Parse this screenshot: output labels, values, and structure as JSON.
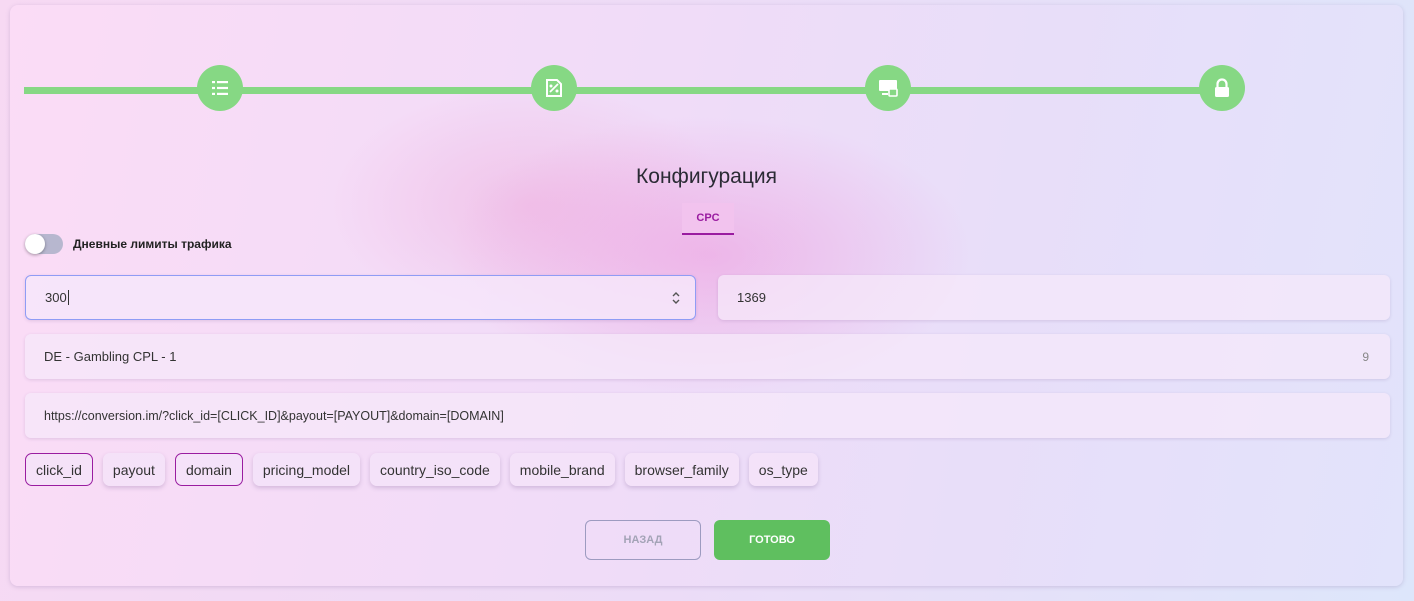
{
  "stepper": {
    "steps": [
      {
        "icon": "list-icon"
      },
      {
        "icon": "pricing-tag-icon"
      },
      {
        "icon": "monitor-icon"
      },
      {
        "icon": "lock-icon"
      }
    ],
    "color": "#86d884"
  },
  "section": {
    "title": "Конфигурация",
    "tab_label": "CPC",
    "accent_color": "#9a1ca0"
  },
  "daily_limits": {
    "label": "Дневные лимиты трафика",
    "enabled": false
  },
  "form": {
    "payout_value": "300",
    "id_value": "1369",
    "offer_value": "DE - Gambling CPL - 1",
    "offer_count": "9",
    "postback_url": "https://conversion.im/?click_id=[CLICK_ID]&payout=[PAYOUT]&domain=[DOMAIN]"
  },
  "macros": [
    {
      "label": "click_id",
      "selected": true
    },
    {
      "label": "payout",
      "selected": false
    },
    {
      "label": "domain",
      "selected": true
    },
    {
      "label": "pricing_model",
      "selected": false
    },
    {
      "label": "country_iso_code",
      "selected": false
    },
    {
      "label": "mobile_brand",
      "selected": false
    },
    {
      "label": "browser_family",
      "selected": false
    },
    {
      "label": "os_type",
      "selected": false
    }
  ],
  "buttons": {
    "back_label": "НАЗАД",
    "done_label": "ГОТОВО",
    "done_color": "#5fbf5f"
  }
}
